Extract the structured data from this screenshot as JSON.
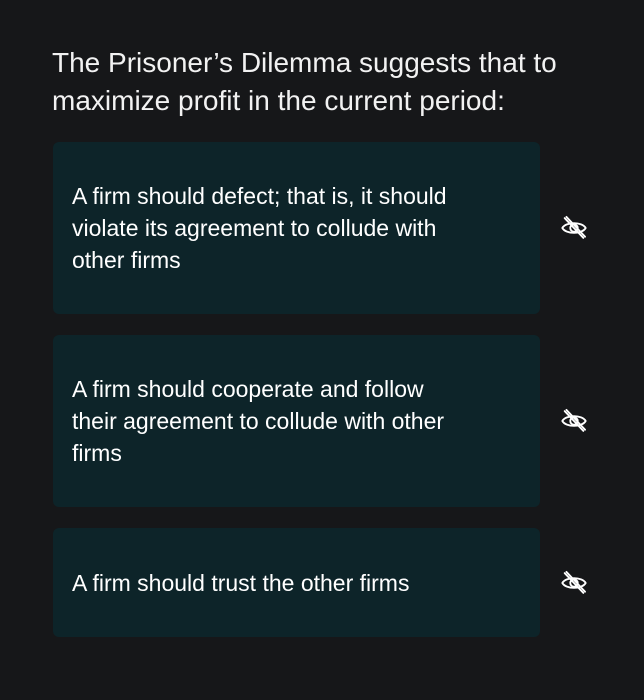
{
  "question": {
    "text": "The Prisoner’s Dilemma suggests that to maximize profit in the current period:"
  },
  "options": [
    {
      "label": "A firm should defect; that is, it should violate its agreement to collude with other firms",
      "toggle_icon": "eye-off-icon"
    },
    {
      "label": "A firm should cooperate and follow their agreement to collude with other firms",
      "toggle_icon": "eye-off-icon"
    },
    {
      "label": "A firm should trust the other firms",
      "toggle_icon": "eye-off-icon"
    }
  ],
  "colors": {
    "background": "#161719",
    "option_background": "#0d2429",
    "text": "#ffffff",
    "icon": "#ffffff"
  }
}
